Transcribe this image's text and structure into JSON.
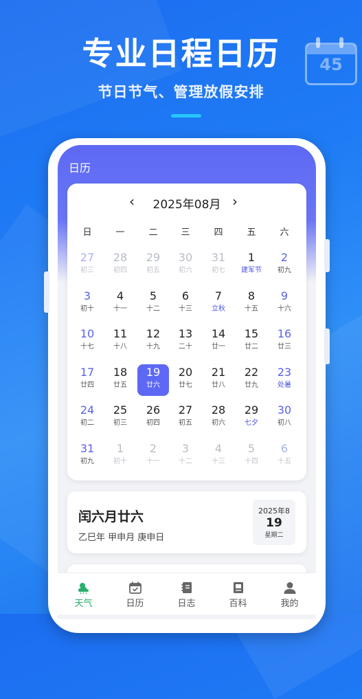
{
  "promo": {
    "title": "专业日程日历",
    "subtitle": "节日节气、管理放假安排",
    "icon_number": "45"
  },
  "screen": {
    "title": "日历"
  },
  "calendar": {
    "month_label": "2025年08月",
    "prev_icon": "‹",
    "next_icon": "›",
    "weekdays": [
      "日",
      "一",
      "二",
      "三",
      "四",
      "五",
      "六"
    ],
    "weeks": [
      [
        {
          "n": "27",
          "l": "初三",
          "dim": true
        },
        {
          "n": "28",
          "l": "初四",
          "dim": true
        },
        {
          "n": "29",
          "l": "初五",
          "dim": true
        },
        {
          "n": "30",
          "l": "初六",
          "dim": true
        },
        {
          "n": "31",
          "l": "初七",
          "dim": true
        },
        {
          "n": "1",
          "l": "建军节",
          "fest": true
        },
        {
          "n": "2",
          "l": "初九"
        }
      ],
      [
        {
          "n": "3",
          "l": "初十"
        },
        {
          "n": "4",
          "l": "十一"
        },
        {
          "n": "5",
          "l": "十二"
        },
        {
          "n": "6",
          "l": "十三"
        },
        {
          "n": "7",
          "l": "立秋",
          "fest": true
        },
        {
          "n": "8",
          "l": "十五"
        },
        {
          "n": "9",
          "l": "十六"
        }
      ],
      [
        {
          "n": "10",
          "l": "十七"
        },
        {
          "n": "11",
          "l": "十八"
        },
        {
          "n": "12",
          "l": "十九"
        },
        {
          "n": "13",
          "l": "二十"
        },
        {
          "n": "14",
          "l": "廿一"
        },
        {
          "n": "15",
          "l": "廿二"
        },
        {
          "n": "16",
          "l": "廿三"
        }
      ],
      [
        {
          "n": "17",
          "l": "廿四"
        },
        {
          "n": "18",
          "l": "廿五"
        },
        {
          "n": "19",
          "l": "廿六",
          "sel": true
        },
        {
          "n": "20",
          "l": "廿七"
        },
        {
          "n": "21",
          "l": "廿八"
        },
        {
          "n": "22",
          "l": "廿九"
        },
        {
          "n": "23",
          "l": "处暑",
          "fest": true
        }
      ],
      [
        {
          "n": "24",
          "l": "初二"
        },
        {
          "n": "25",
          "l": "初三"
        },
        {
          "n": "26",
          "l": "初四"
        },
        {
          "n": "27",
          "l": "初五"
        },
        {
          "n": "28",
          "l": "初六"
        },
        {
          "n": "29",
          "l": "七夕",
          "fest": true
        },
        {
          "n": "30",
          "l": "初八"
        }
      ],
      [
        {
          "n": "31",
          "l": "初九"
        },
        {
          "n": "1",
          "l": "初十",
          "dim": true
        },
        {
          "n": "2",
          "l": "十一",
          "dim": true
        },
        {
          "n": "3",
          "l": "十二",
          "dim": true
        },
        {
          "n": "4",
          "l": "十三",
          "dim": true
        },
        {
          "n": "5",
          "l": "十四",
          "dim": true
        },
        {
          "n": "6",
          "l": "十五",
          "dim": true
        }
      ]
    ]
  },
  "day_info": {
    "lunar": "闰六月廿六",
    "ganzhi": "乙巳年 甲申月 庚申日",
    "year_month": "2025年8",
    "day": "19",
    "weekday": "星期二"
  },
  "tabs": [
    {
      "label": "天气",
      "icon": "weather-icon",
      "active": true
    },
    {
      "label": "日历",
      "icon": "calendar-icon"
    },
    {
      "label": "日志",
      "icon": "notebook-icon"
    },
    {
      "label": "百科",
      "icon": "book-icon"
    },
    {
      "label": "我的",
      "icon": "user-icon"
    }
  ],
  "colors": {
    "accent": "#5d69f4",
    "weekend": "#5a62e8",
    "tab_active": "#27b06a"
  }
}
